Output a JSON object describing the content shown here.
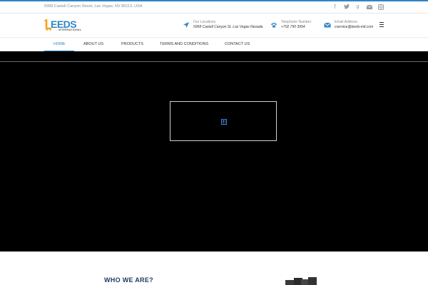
{
  "topbar": {
    "address": "5958 Castell Canyon Street, Las Vegas, NV 89113, USA",
    "social_icons": [
      "facebook-icon",
      "twitter-icon",
      "google-plus-icon",
      "mail-icon",
      "instagram-icon"
    ]
  },
  "header": {
    "logo_text": "EEDS",
    "logo_subtext": "INTERNATIONAL",
    "location_label": "Our Locations",
    "location_value": "5958 Castell Canyon St. Las Vegas Nevada",
    "phone_label": "Telephone Number",
    "phone_value": "+702 790 3954",
    "email_label": "Email Address",
    "email_value": "cservice@leeds-intl.com"
  },
  "nav": {
    "items": [
      {
        "label": "HOME"
      },
      {
        "label": "ABOUT US"
      },
      {
        "label": "PRODUCTS"
      },
      {
        "label": "TERMS AND CONDITIONS"
      },
      {
        "label": "CONTACT US"
      }
    ],
    "active_index": 0
  },
  "about": {
    "title": "WHO WE ARE?"
  },
  "colors": {
    "accent": "#2e86c8",
    "hero_bg": "#000000",
    "heading": "#1f3b63"
  }
}
